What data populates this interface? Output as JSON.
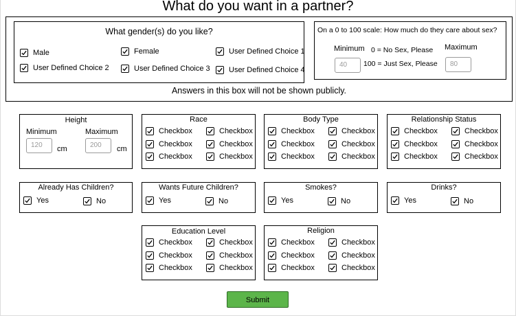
{
  "page": {
    "title": "What do you want in a partner?"
  },
  "private_box": {
    "note": "Answers in this box will not be shown publicly."
  },
  "gender": {
    "title": "What gender(s) do you like?",
    "options": [
      "Male",
      "Female",
      "User Defined Choice 1",
      "User Defined Choice 2",
      "User Defined Choice 3",
      "User Defined Choice 4"
    ]
  },
  "sex_scale": {
    "question": "On a 0 to 100 scale: How much do they care about sex?",
    "min_label": "Minimum",
    "max_label": "Maximum",
    "min_placeholder": "40",
    "max_placeholder": "80",
    "low_note": "0 = No Sex, Please",
    "high_note": "100 = Just Sex, Please"
  },
  "height": {
    "title": "Height",
    "min_label": "Minimum",
    "max_label": "Maximum",
    "min_placeholder": "120",
    "max_placeholder": "200",
    "unit": "cm"
  },
  "checkbox_label": "Checkbox",
  "grids": {
    "race": {
      "title": "Race"
    },
    "body_type": {
      "title": "Body Type"
    },
    "relationship": {
      "title": "Relationship Status"
    },
    "education": {
      "title": "Education Level"
    },
    "religion": {
      "title": "Religion"
    }
  },
  "yesno": {
    "yes": "Yes",
    "no": "No",
    "children": {
      "title": "Already Has Children?"
    },
    "future_children": {
      "title": "Wants Future Children?"
    },
    "smokes": {
      "title": "Smokes?"
    },
    "drinks": {
      "title": "Drinks?"
    }
  },
  "submit": {
    "label": "Submit"
  },
  "colors": {
    "submit_bg": "#5cb54a",
    "placeholder": "#9a9a9a"
  }
}
